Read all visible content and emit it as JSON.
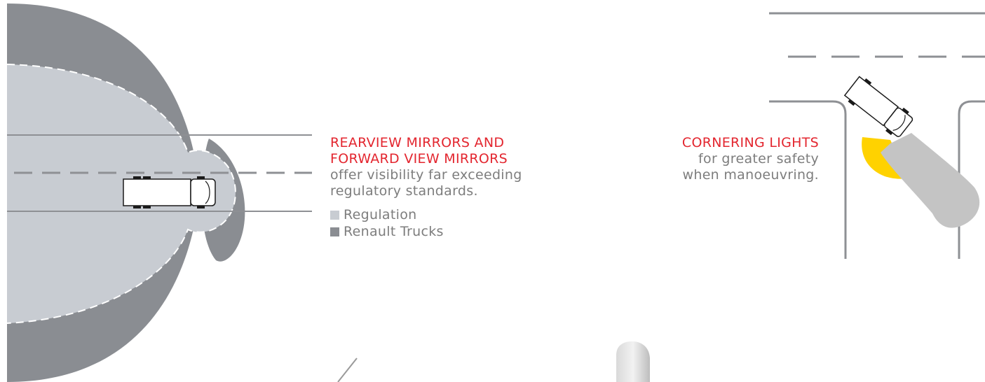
{
  "mirrors_section": {
    "title_line_1": "REARVIEW MIRRORS AND",
    "title_line_2": "FORWARD VIEW MIRRORS",
    "desc_line_1": "offer visibility far exceeding",
    "desc_line_2": "regulatory standards."
  },
  "legend": {
    "items": [
      {
        "label": "Regulation",
        "color": "#c8ccd2"
      },
      {
        "label": "Renault Trucks",
        "color": "#8a8d92"
      }
    ]
  },
  "cornering_section": {
    "title": "CORNERING LIGHTS",
    "desc_line_1": "for greater safety",
    "desc_line_2": "when manoeuvring."
  },
  "colors": {
    "accent_red": "#e3262f",
    "text_gray": "#7d7d7d",
    "zone_regulation": "#c8ccd2",
    "zone_renault": "#8a8d92",
    "beam_gray": "#c4c4c4",
    "light_yellow": "#ffd200",
    "road_line": "#8e9094"
  }
}
